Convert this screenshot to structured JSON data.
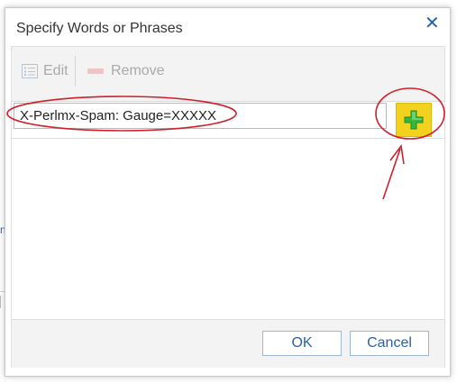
{
  "background": {
    "fragment_text": "n"
  },
  "dialog": {
    "title": "Specify Words or Phrases",
    "close_glyph": "✕"
  },
  "toolbar": {
    "edit_label": "Edit",
    "remove_label": "Remove"
  },
  "input": {
    "value": "X-Perlmx-Spam: Gauge=XXXXX"
  },
  "add_button": {
    "icon": "plus-icon"
  },
  "footer": {
    "ok_label": "OK",
    "cancel_label": "Cancel"
  },
  "colors": {
    "accent": "#2b5fab",
    "add_button": "#f2d21d",
    "plus": "#2fb33a",
    "annotation": "#d0202a"
  }
}
